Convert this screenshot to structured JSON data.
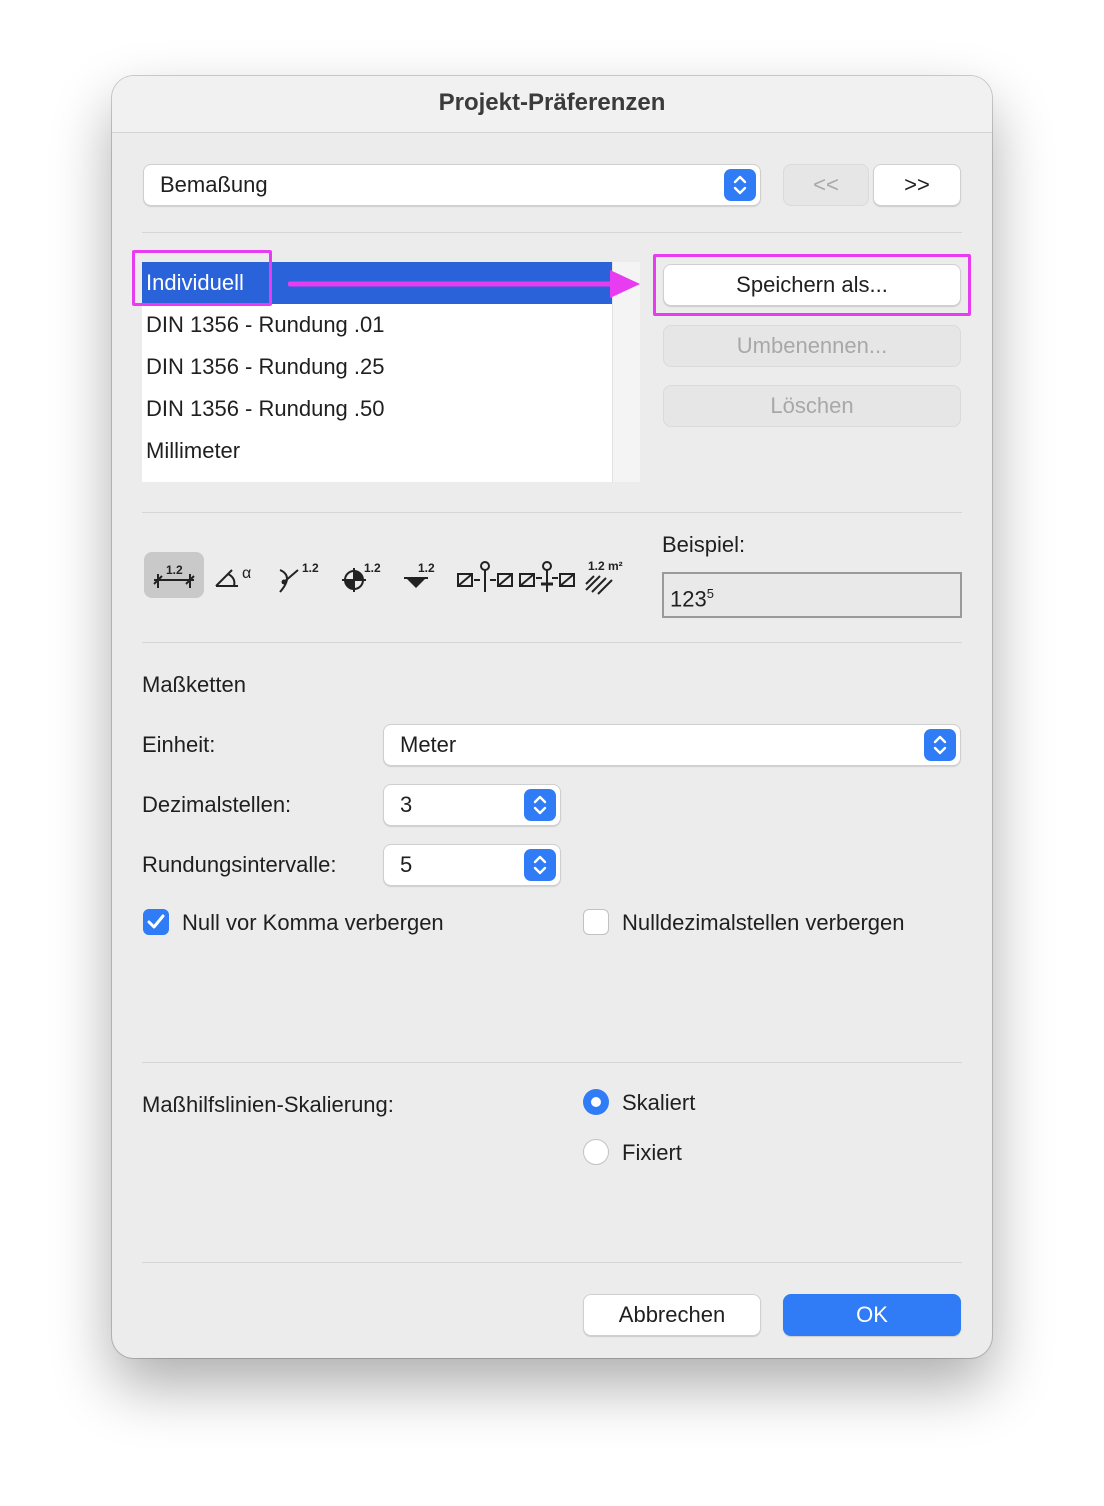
{
  "window": {
    "title": "Projekt-Präferenzen"
  },
  "category": {
    "selected": "Bemaßung"
  },
  "nav": {
    "prev_label": "<<",
    "next_label": ">>"
  },
  "presets": {
    "items": [
      {
        "label": "Individuell",
        "selected": true
      },
      {
        "label": "DIN 1356 - Rundung .01",
        "selected": false
      },
      {
        "label": "DIN 1356 - Rundung .25",
        "selected": false
      },
      {
        "label": "DIN 1356 - Rundung .50",
        "selected": false
      },
      {
        "label": "Millimeter",
        "selected": false
      }
    ],
    "save_as_label": "Speichern als...",
    "rename_label": "Umbenennen...",
    "delete_label": "Löschen"
  },
  "tools": [
    {
      "name": "linear-dimension-icon",
      "text": "1.2"
    },
    {
      "name": "angle-dimension-icon",
      "text": "α"
    },
    {
      "name": "radial-dimension-icon",
      "text": "1.2"
    },
    {
      "name": "level-dimension-icon",
      "text": "1.2"
    },
    {
      "name": "elevation-dimension-icon",
      "text": "1.2"
    },
    {
      "name": "door-window-dimension-icon",
      "text": ""
    },
    {
      "name": "sill-height-dimension-icon",
      "text": ""
    },
    {
      "name": "area-dimension-icon",
      "text": "1.2 m²"
    }
  ],
  "example": {
    "label": "Beispiel:",
    "value": "123",
    "superscript": "5"
  },
  "section": {
    "title": "Maßketten",
    "unit_label": "Einheit:",
    "unit_value": "Meter",
    "decimals_label": "Dezimalstellen:",
    "decimals_value": "3",
    "rounding_label": "Rundungsintervalle:",
    "rounding_value": "5",
    "hide_zero_label": "Null vor Komma verbergen",
    "hide_zero_checked": true,
    "hide_zero_decimals_label": "Nulldezimalstellen verbergen",
    "hide_zero_decimals_checked": false
  },
  "scaling": {
    "label": "Maßhilfslinien-Skalierung:",
    "options": [
      {
        "label": "Skaliert",
        "selected": true
      },
      {
        "label": "Fixiert",
        "selected": false
      }
    ]
  },
  "footer": {
    "cancel_label": "Abbrechen",
    "ok_label": "OK"
  },
  "colors": {
    "accent": "#2f7cf6",
    "selection": "#2a62d9",
    "annotation": "#e83cf0"
  }
}
